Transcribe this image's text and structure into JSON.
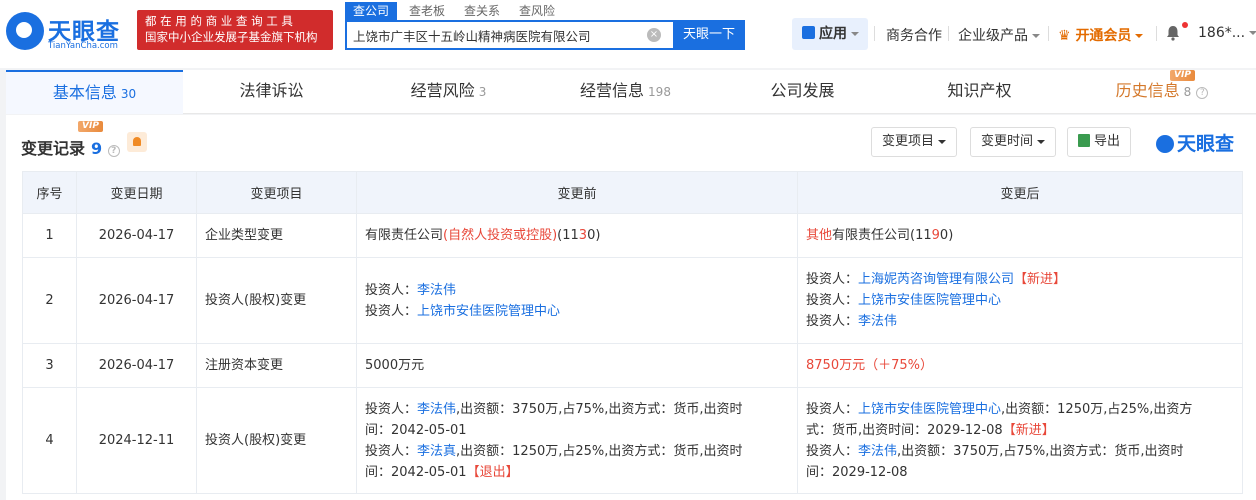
{
  "header": {
    "logo_text": "天眼查",
    "logo_sub": "TianYanCha.com",
    "slogan_line1": "都 在 用 的 商 业 查 询 工 具",
    "slogan_line2": "国家中小企业发展子基金旗下机构",
    "search_tabs": [
      "查公司",
      "查老板",
      "查关系",
      "查风险"
    ],
    "search_value": "上饶市广丰区十五岭山精神病医院有限公司",
    "search_button": "天眼一下",
    "nav_app": "应用",
    "nav_items": [
      "商务合作",
      "企业级产品",
      "开通会员"
    ],
    "user": "186*..."
  },
  "tabs": [
    {
      "label": "基本信息",
      "count": "30"
    },
    {
      "label": "法律诉讼",
      "count": ""
    },
    {
      "label": "经营风险",
      "count": "3"
    },
    {
      "label": "经营信息",
      "count": "198"
    },
    {
      "label": "公司发展",
      "count": ""
    },
    {
      "label": "知识产权",
      "count": ""
    },
    {
      "label": "历史信息",
      "count": "8"
    }
  ],
  "vip_label": "VIP",
  "section": {
    "title": "变更记录",
    "count": "9",
    "buttons": [
      "变更项目",
      "变更时间",
      "导出"
    ],
    "brand": "天眼查"
  },
  "table": {
    "headers": [
      "序号",
      "变更日期",
      "变更项目",
      "变更前",
      "变更后"
    ],
    "rows": [
      {
        "no": "1",
        "date": "2026-04-17",
        "item": "企业类型变更"
      },
      {
        "no": "2",
        "date": "2026-04-17",
        "item": "投资人(股权)变更"
      },
      {
        "no": "3",
        "date": "2026-04-17",
        "item": "注册资本变更"
      },
      {
        "no": "4",
        "date": "2024-12-11",
        "item": "投资人(股权)变更"
      }
    ],
    "r1_before": {
      "a": "有限责任公司",
      "b": "(自然人投资或控股)",
      "c": "(11",
      "d": "3",
      "e": "0)"
    },
    "r1_after": {
      "a": "其他",
      "b": "有限责任公司(11",
      "c": "9",
      "d": "0)"
    },
    "label_investor": "投资人：",
    "r2_before": [
      "李法伟",
      "上饶市安佳医院管理中心"
    ],
    "r2_after": [
      "上海妮芮咨询管理有限公司",
      "【新进】",
      "上饶市安佳医院管理中心",
      "李法伟"
    ],
    "r3_before": "5000万元",
    "r3_after": "8750万元（＋75%）",
    "r4_before": {
      "n1": "李法伟",
      "t1": ",出资额：3750万,占75%,出资方式：货币,出资时",
      "t1b": "间：2042-05-01",
      "n2": "李法真",
      "t2": ",出资额：1250万,占25%,出资方式：货币,出资时",
      "t2b": "间：2042-05-01",
      "tag2": "【退出】"
    },
    "r4_after": {
      "n1": "上饶市安佳医院管理中心",
      "t1": ",出资额：1250万,占25%,出资方",
      "t1b": "式：货币,出资时间：2029-12-08",
      "tag1": "【新进】",
      "n2": "李法伟",
      "t2": ",出资额：3750万,占75%,出资方式：货币,出资时",
      "t2b": "间：2029-12-08"
    }
  }
}
